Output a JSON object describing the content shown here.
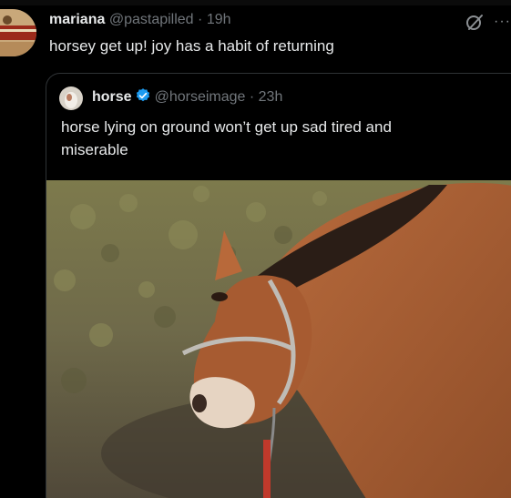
{
  "tweet": {
    "author_name": "mariana",
    "author_handle": "@pastapilled",
    "separator": "·",
    "time": "19h",
    "text": "horsey get up! joy has a habit of returning",
    "grok_icon": "grok-icon",
    "more_icon": "more-icon",
    "more_glyph": "···"
  },
  "quote": {
    "author_name": "horse",
    "verified_icon": "verified-badge-icon",
    "author_handle": "@horseimage",
    "separator": "·",
    "time": "23h",
    "text": "horse lying on ground won’t get up sad tired and miserable",
    "media_description_icon": "horse-lying-photo"
  },
  "colors": {
    "background": "#000000",
    "text": "#e7e9ea",
    "secondary_text": "#71767b",
    "border": "#2f3336",
    "verified": "#1d9bf0"
  }
}
